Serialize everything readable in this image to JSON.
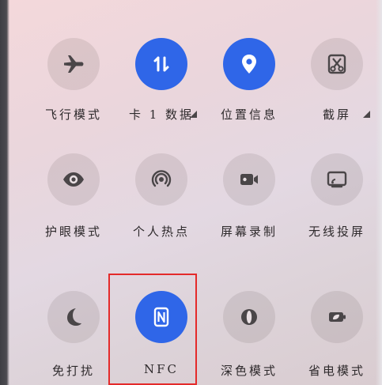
{
  "tiles": [
    {
      "label": "飞行模式",
      "icon": "airplane-icon",
      "active": false,
      "dropdown": false
    },
    {
      "label": "卡 1 数据",
      "icon": "mobile-data-arrows-icon",
      "active": true,
      "dropdown": true
    },
    {
      "label": "位置信息",
      "icon": "location-pin-icon",
      "active": true,
      "dropdown": false
    },
    {
      "label": "截屏",
      "icon": "screenshot-scissors-icon",
      "active": false,
      "dropdown": true
    },
    {
      "label": "护眼模式",
      "icon": "eye-icon",
      "active": false,
      "dropdown": false
    },
    {
      "label": "个人热点",
      "icon": "hotspot-icon",
      "active": false,
      "dropdown": false
    },
    {
      "label": "屏幕录制",
      "icon": "screen-record-camera-icon",
      "active": false,
      "dropdown": false
    },
    {
      "label": "无线投屏",
      "icon": "wireless-projection-icon",
      "active": false,
      "dropdown": false
    },
    {
      "label": "免打扰",
      "icon": "moon-icon",
      "active": false,
      "dropdown": false
    },
    {
      "label": "NFC",
      "icon": "nfc-icon",
      "active": true,
      "dropdown": false
    },
    {
      "label": "深色模式",
      "icon": "dark-mode-icon",
      "active": false,
      "dropdown": false
    },
    {
      "label": "省电模式",
      "icon": "battery-leaf-icon",
      "active": false,
      "dropdown": false
    }
  ],
  "colors": {
    "active": "#2f66e8",
    "inactive_icon": "#4a4648",
    "highlight": "#e42a2a"
  }
}
